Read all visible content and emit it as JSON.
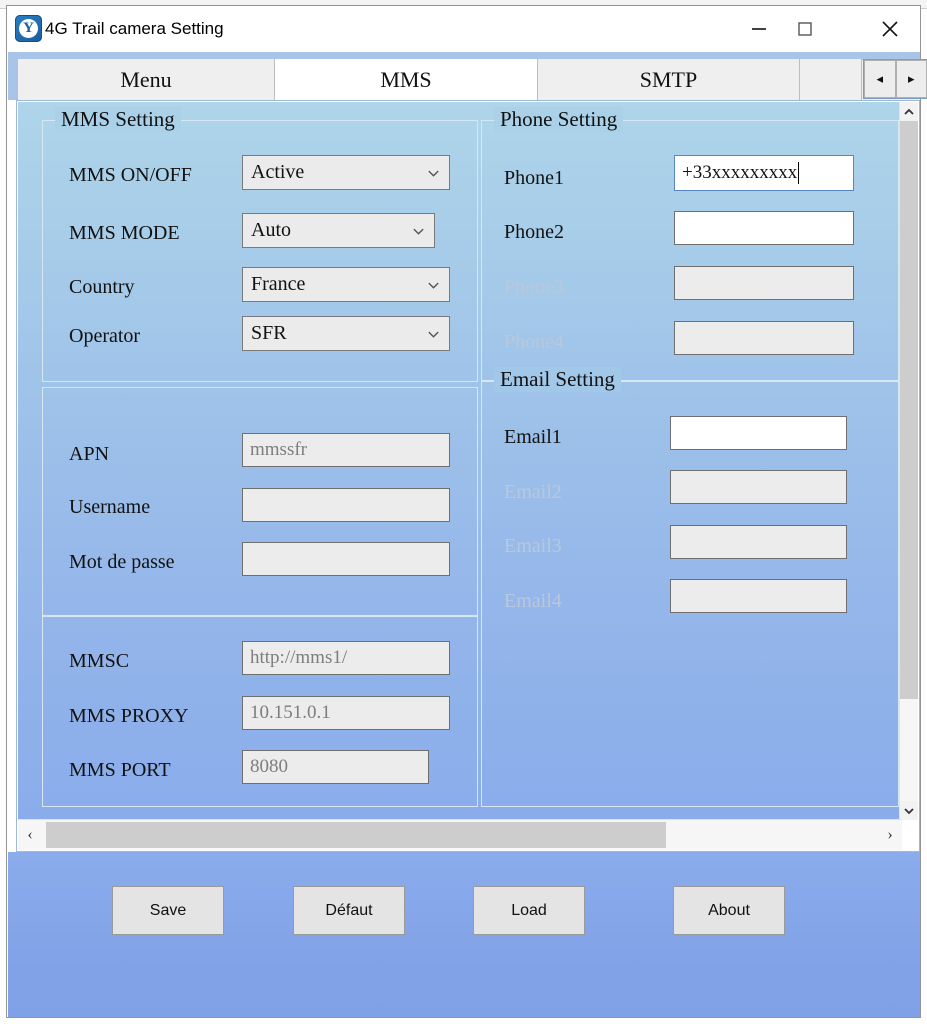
{
  "window": {
    "title": "4G Trail camera Setting",
    "icon": "app-logo-icon",
    "minimize_label": "—",
    "maximize_label": "□",
    "close_label": "✕"
  },
  "tabs": {
    "items": [
      {
        "label": "Menu",
        "active": false
      },
      {
        "label": "MMS",
        "active": true
      },
      {
        "label": "SMTP",
        "active": false
      }
    ],
    "nav_prev": "◂",
    "nav_next": "▸"
  },
  "mms_setting": {
    "title": "MMS Setting",
    "rows": [
      {
        "label": "MMS ON/OFF",
        "value": "Active",
        "type": "combo",
        "disabled": false
      },
      {
        "label": "MMS MODE",
        "value": "Auto",
        "type": "combo",
        "disabled": false
      },
      {
        "label": "Country",
        "value": "France",
        "type": "combo",
        "disabled": false
      },
      {
        "label": "Operator",
        "value": "SFR",
        "type": "combo",
        "disabled": false
      }
    ]
  },
  "apn_setting": {
    "rows": [
      {
        "label": "APN",
        "value": "mmssfr",
        "type": "text",
        "disabled": false
      },
      {
        "label": "Username",
        "value": "",
        "type": "text",
        "disabled": false
      },
      {
        "label": "Mot de passe",
        "value": "",
        "type": "text",
        "disabled": false
      }
    ]
  },
  "mmsc_setting": {
    "rows": [
      {
        "label": "MMSC",
        "value": "http://mms1/",
        "type": "text",
        "disabled": false
      },
      {
        "label": "MMS PROXY",
        "value": "10.151.0.1",
        "type": "text",
        "disabled": false
      },
      {
        "label": "MMS PORT",
        "value": "8080",
        "type": "text",
        "disabled": false
      }
    ]
  },
  "phone_setting": {
    "title": "Phone Setting",
    "rows": [
      {
        "label": "Phone1",
        "value": "+33xxxxxxxxx",
        "disabled": false,
        "focused": true
      },
      {
        "label": "Phone2",
        "value": "",
        "disabled": false,
        "focused": false
      },
      {
        "label": "Phone3",
        "value": "",
        "disabled": true,
        "focused": false
      },
      {
        "label": "Phone4",
        "value": "",
        "disabled": true,
        "focused": false
      }
    ]
  },
  "email_setting": {
    "title": "Email Setting",
    "rows": [
      {
        "label": "Email1",
        "value": "",
        "disabled": false
      },
      {
        "label": "Email2",
        "value": "",
        "disabled": true
      },
      {
        "label": "Email3",
        "value": "",
        "disabled": true
      },
      {
        "label": "Email4",
        "value": "",
        "disabled": true
      }
    ]
  },
  "scrollbars": {
    "vertical": {
      "up": "⌃",
      "down": "⌄"
    },
    "horizontal": {
      "left": "‹",
      "right": "›"
    }
  },
  "footer": {
    "buttons": [
      {
        "label": "Save"
      },
      {
        "label": "Défaut"
      },
      {
        "label": "Load"
      },
      {
        "label": "About"
      }
    ]
  },
  "colors": {
    "titlebar_bg": "#ffffff",
    "tabstrip_bg": "#a8c4e8",
    "panel_top": "#aed5ea",
    "panel_bottom": "#8aaceb",
    "footer_bg": "#83a3e8",
    "button_bg": "#e4e4e4",
    "field_bg": "#ececec",
    "disabled_text": "#b9c8dc"
  }
}
